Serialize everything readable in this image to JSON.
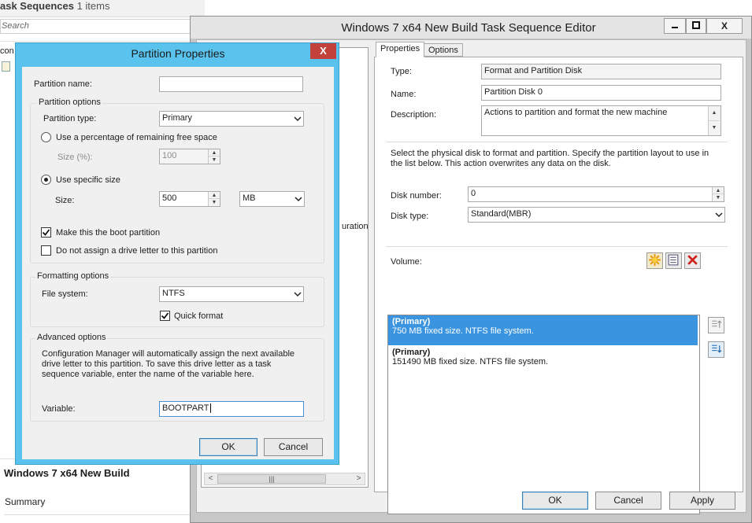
{
  "background": {
    "header_title": "ask Sequences",
    "header_count": "1 items",
    "search_placeholder": "Search",
    "list_fragment": "con",
    "bottom_title": "Windows 7 x64 New Build",
    "bottom_summary": "Summary"
  },
  "editor": {
    "title": "Windows 7 x64 New Build Task Sequence Editor",
    "window_buttons": {
      "minimize": "—",
      "maximize": "□",
      "close": "X"
    },
    "tree_fragment": "uration",
    "tabs": [
      "Properties",
      "Options"
    ],
    "fields": {
      "type_label": "Type:",
      "type_value": "Format and Partition Disk",
      "name_label": "Name:",
      "name_value": "Partition Disk 0",
      "description_label": "Description:",
      "description_value": "Actions to partition and format the new machine"
    },
    "instructions": "Select the physical disk to format and partition. Specify the partition layout to use in the list below. This action overwrites any data on the disk.",
    "disk_number_label": "Disk number:",
    "disk_number_value": "0",
    "disk_type_label": "Disk type:",
    "disk_type_value": "Standard(MBR)",
    "volume_label": "Volume:",
    "volumes": [
      {
        "title": "(Primary)",
        "detail": "750 MB fixed size. NTFS file system."
      },
      {
        "title": "(Primary)",
        "detail": "151490 MB fixed size. NTFS file system."
      }
    ],
    "buttons": {
      "ok": "OK",
      "cancel": "Cancel",
      "apply": "Apply"
    }
  },
  "dialog": {
    "title": "Partition Properties",
    "close": "X",
    "partition_name_label": "Partition name:",
    "partition_name_value": "",
    "partition_options_title": "Partition options",
    "partition_type_label": "Partition type:",
    "partition_type_value": "Primary",
    "use_percentage_label": "Use a percentage of remaining free space",
    "size_percent_label": "Size (%):",
    "size_percent_value": "100",
    "use_specific_label": "Use specific size",
    "size_label": "Size:",
    "size_value": "500",
    "size_unit": "MB",
    "boot_label": "Make this the boot partition",
    "no_letter_label": "Do not assign a drive letter to this partition",
    "formatting_title": "Formatting options",
    "file_system_label": "File system:",
    "file_system_value": "NTFS",
    "quick_format_label": "Quick format",
    "advanced_title": "Advanced options",
    "advanced_text": "Configuration Manager will automatically assign the next available drive letter to this partition. To save this drive letter as a task sequence variable, enter the name of the variable here.",
    "variable_label": "Variable:",
    "variable_value": "BOOTPART",
    "ok": "OK",
    "cancel": "Cancel"
  }
}
